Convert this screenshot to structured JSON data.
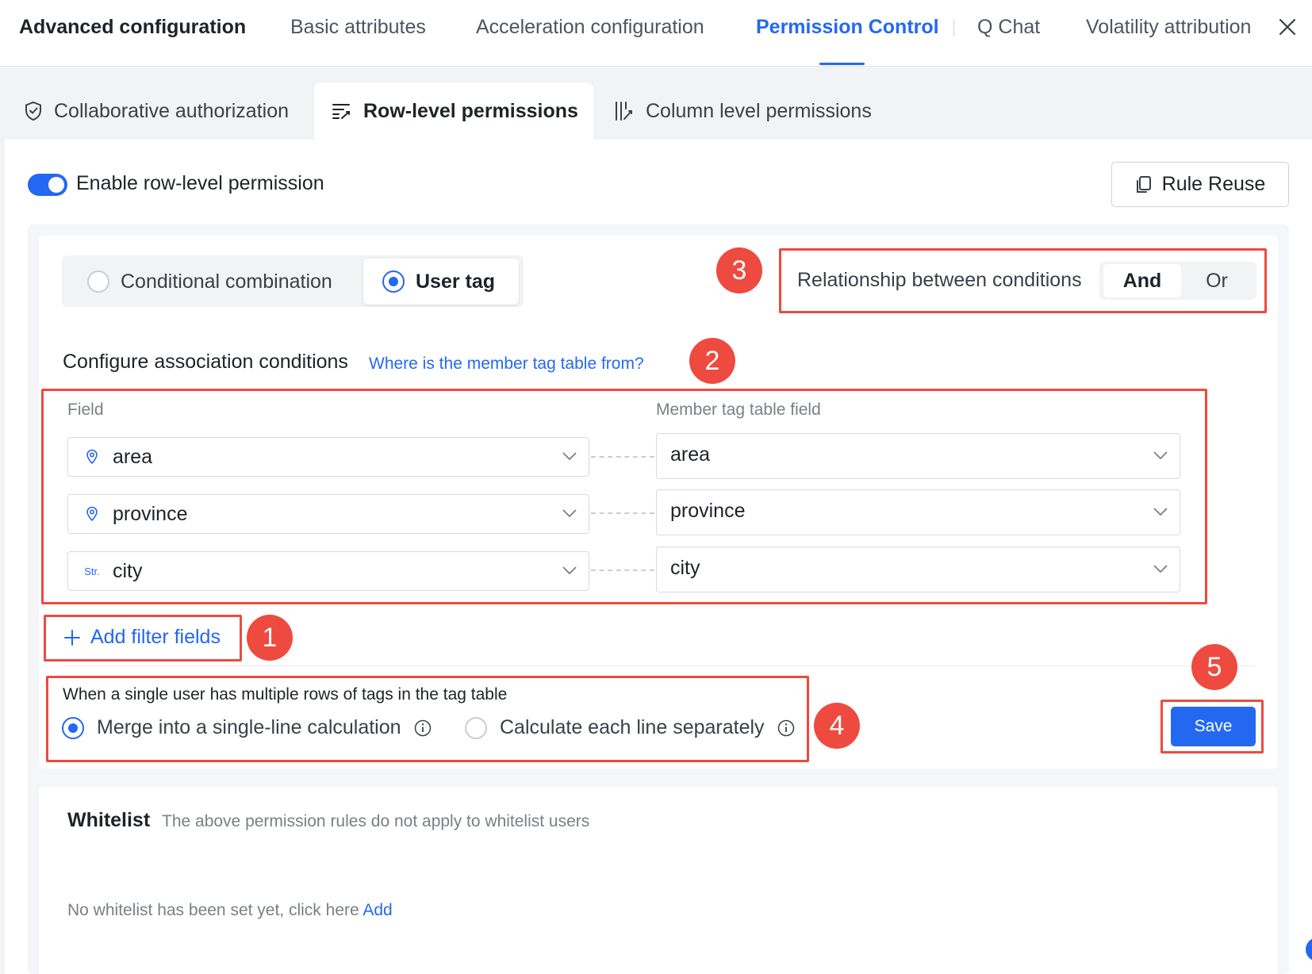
{
  "top_tabs": [
    {
      "label": "Advanced configuration"
    },
    {
      "label": "Basic attributes"
    },
    {
      "label": "Acceleration configuration"
    },
    {
      "label": "Permission Control",
      "active": true
    },
    {
      "label": "Q Chat"
    },
    {
      "label": "Volatility attribution"
    }
  ],
  "sub_tabs": [
    {
      "label": "Collaborative authorization",
      "icon": "shield-check-icon"
    },
    {
      "label": "Row-level permissions",
      "icon": "row-filter-icon",
      "active": true
    },
    {
      "label": "Column level permissions",
      "icon": "column-filter-icon"
    }
  ],
  "row_permission": {
    "toggle_label": "Enable row-level permission",
    "toggle_on": true,
    "rule_reuse_label": "Rule Reuse"
  },
  "mode": {
    "options": [
      "Conditional combination",
      "User tag"
    ],
    "selected": "User tag"
  },
  "relationship": {
    "label": "Relationship between conditions",
    "options": [
      "And",
      "Or"
    ],
    "selected": "And"
  },
  "association": {
    "title": "Configure association conditions",
    "help_link": "Where is the member tag table from?",
    "field_header": "Field",
    "member_header": "Member tag table field",
    "rows": [
      {
        "field": "area",
        "field_type_icon": "geo-icon",
        "member_field": "area"
      },
      {
        "field": "province",
        "field_type_icon": "geo-icon",
        "member_field": "province"
      },
      {
        "field": "city",
        "field_type_icon": "string-type-icon",
        "field_type_text": "Str.",
        "member_field": "city"
      }
    ],
    "add_label": "Add filter fields"
  },
  "multi_rows": {
    "title": "When a single user has multiple rows of tags in the tag table",
    "options": [
      "Merge into a single-line calculation",
      "Calculate each line separately"
    ],
    "selected": "Merge into a single-line calculation"
  },
  "save_label": "Save",
  "markers": [
    "1",
    "2",
    "3",
    "4",
    "5"
  ],
  "whitelist": {
    "title": "Whitelist",
    "description": "The above permission rules do not apply to whitelist users",
    "empty_text": "No whitelist has been set yet, click here",
    "add_label": "Add"
  },
  "colors": {
    "accent": "#2468f2",
    "highlight": "#ee4a3f"
  }
}
